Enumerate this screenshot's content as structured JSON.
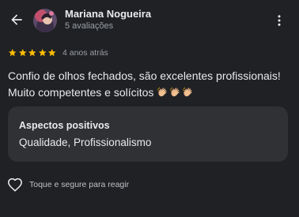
{
  "header": {
    "reviewer_name": "Mariana Nogueira",
    "review_count": "5 avaliações",
    "back_icon": "arrow-left-icon",
    "more_icon": "more-vertical-icon"
  },
  "review": {
    "rating": 5,
    "rating_max": 5,
    "time_ago": "4 anos atrás",
    "text_line_1": "Confio de olhos fechados, são excelentes profissionais!",
    "text_line_2": "Muito competentes e solícitos",
    "emoji_count": 3
  },
  "positives": {
    "title": "Aspectos positivos",
    "value": "Qualidade, Profissionalismo"
  },
  "reaction": {
    "label": "Toque e segure para reagir",
    "icon": "heart-outline-icon"
  },
  "colors": {
    "background": "#202124",
    "card": "#303134",
    "star": "#fbbc04",
    "primary_text": "#e8eaed",
    "secondary_text": "#9aa0a6"
  }
}
